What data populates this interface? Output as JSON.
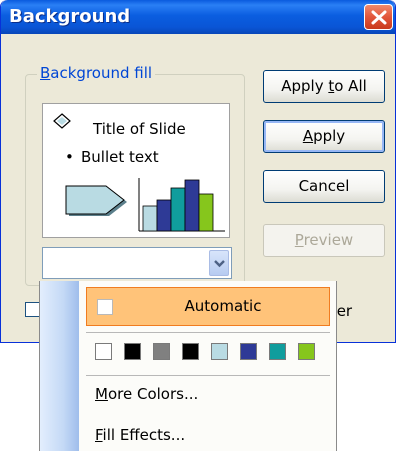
{
  "window": {
    "title": "Background"
  },
  "group": {
    "label_prefix": "",
    "label_key": "B",
    "label_rest": "ackground fill"
  },
  "preview": {
    "title": "Title of Slide",
    "bullet_dot": "•",
    "bullet": "Bullet text"
  },
  "buttons": {
    "apply_all_pre": "Apply ",
    "apply_all_key": "t",
    "apply_all_post": "o All",
    "apply_key": "A",
    "apply_post": "pply",
    "cancel": "Cancel",
    "preview_key": "P",
    "preview_post": "review"
  },
  "checkbox": {
    "tail": "ster"
  },
  "popup": {
    "automatic": "Automatic",
    "swatch_colors": [
      "#ffffff",
      "#000000",
      "#808080",
      "#000000",
      "#b9dbe3",
      "#2e3a96",
      "#109d9d",
      "#86c61c"
    ],
    "more_key": "M",
    "more_rest": "ore Colors...",
    "fill_key": "F",
    "fill_rest": "ill Effects..."
  },
  "colors": {
    "titlebar": "#0a5bde",
    "group_label": "#0046d5",
    "highlight": "#ffc379",
    "highlight_border": "#f07c20"
  }
}
